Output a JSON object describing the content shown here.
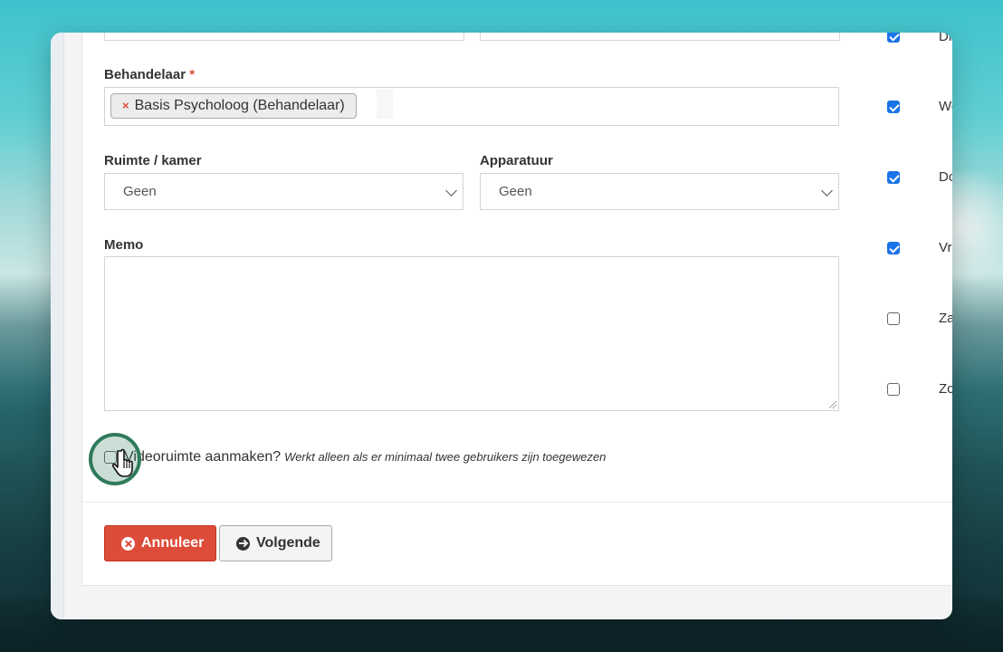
{
  "form": {
    "behandelaar": {
      "label": "Behandelaar",
      "required_mark": "*",
      "selected_tag": "Basis Psycholoog (Behandelaar)",
      "tag_remove": "×"
    },
    "ruimte": {
      "label": "Ruimte / kamer",
      "selected": "Geen"
    },
    "apparatuur": {
      "label": "Apparatuur",
      "selected": "Geen"
    },
    "memo": {
      "label": "Memo",
      "value": ""
    },
    "video": {
      "label": "Videoruimte aanmaken?",
      "hint": "Werkt alleen als er minimaal twee gebruikers zijn toegewezen",
      "checked": false
    }
  },
  "days": [
    {
      "label": "Di",
      "checked": true
    },
    {
      "label": "Wo",
      "checked": true
    },
    {
      "label": "Do",
      "checked": true
    },
    {
      "label": "Vr",
      "checked": true
    },
    {
      "label": "Za",
      "checked": false
    },
    {
      "label": "Zo",
      "checked": false
    }
  ],
  "buttons": {
    "cancel": "Annuleer",
    "next": "Volgende"
  },
  "colors": {
    "danger": "#dd4b39",
    "check": "#1a73e8",
    "cursor": "#2f7a5b"
  }
}
